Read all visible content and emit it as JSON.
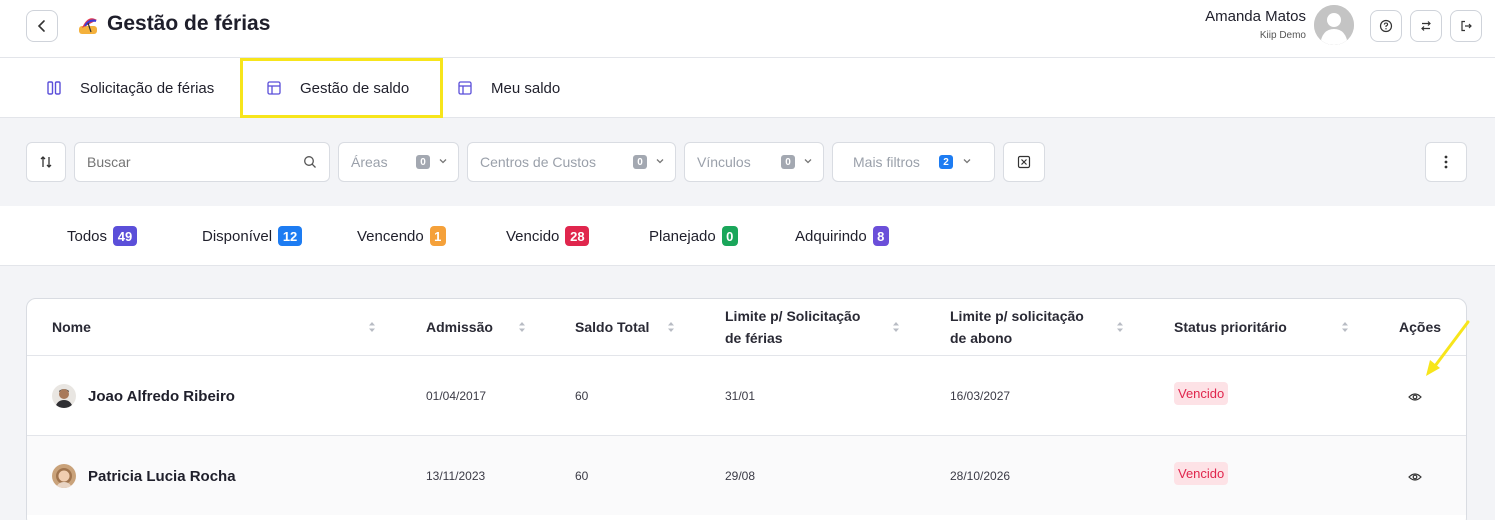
{
  "header": {
    "title": "Gestão de férias",
    "user_name": "Amanda Matos",
    "user_company": "Kiip Demo",
    "icons": [
      "chevron-left-icon",
      "beach-umbrella-logo",
      "help-icon",
      "switch-icon",
      "logout-icon"
    ]
  },
  "tabs": [
    {
      "label": "Solicitação de férias",
      "icon": "columns-icon"
    },
    {
      "label": "Gestão de saldo",
      "icon": "table-icon",
      "highlighted": true
    },
    {
      "label": "Meu saldo",
      "icon": "table-icon"
    }
  ],
  "filters": {
    "search_placeholder": "Buscar",
    "areas": {
      "label": "Áreas",
      "count": "0"
    },
    "centros": {
      "label": "Centros de Custos",
      "count": "0"
    },
    "vinculos": {
      "label": "Vínculos",
      "count": "0"
    },
    "mais_filtros": {
      "label": "Mais filtros",
      "count": "2"
    }
  },
  "status_tabs": [
    {
      "label": "Todos",
      "count": "49",
      "color": "#5b4fd9"
    },
    {
      "label": "Disponível",
      "count": "12",
      "color": "#1d7cf2"
    },
    {
      "label": "Vencendo",
      "count": "1",
      "color": "#f5a13a"
    },
    {
      "label": "Vencido",
      "count": "28",
      "color": "#e0264d"
    },
    {
      "label": "Planejado",
      "count": "0",
      "color": "#1aa65a"
    },
    {
      "label": "Adquirindo",
      "count": "8",
      "color": "#6b4fd9"
    }
  ],
  "table": {
    "headers": {
      "nome": "Nome",
      "admissao": "Admissão",
      "saldo": "Saldo Total",
      "limite_ferias_1": "Limite p/ Solicitação",
      "limite_ferias_2": "de férias",
      "limite_abono_1": "Limite p/ solicitação",
      "limite_abono_2": "de abono",
      "status": "Status prioritário",
      "acoes": "Ações"
    },
    "rows": [
      {
        "nome": "Joao Alfredo Ribeiro",
        "admissao": "01/04/2017",
        "saldo": "60",
        "limite_ferias": "31/01",
        "limite_abono": "16/03/2027",
        "status": "Vencido"
      },
      {
        "nome": "Patricia Lucia Rocha",
        "admissao": "13/11/2023",
        "saldo": "60",
        "limite_ferias": "29/08",
        "limite_abono": "28/10/2026",
        "status": "Vencido"
      }
    ]
  }
}
